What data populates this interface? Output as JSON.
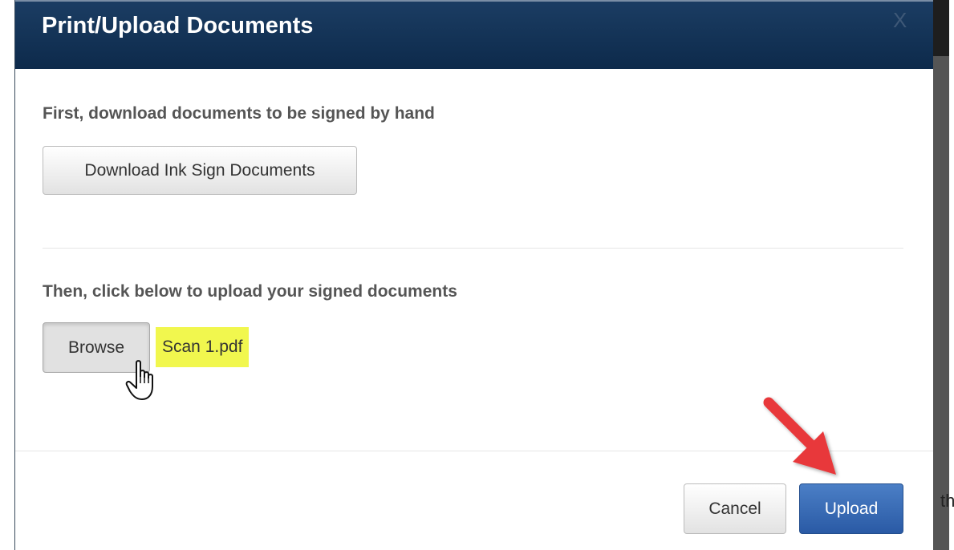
{
  "dialog": {
    "title": "Print/Upload Documents",
    "close_label": "X"
  },
  "step1": {
    "label": "First, download documents to be signed by hand",
    "button_label": "Download Ink Sign Documents"
  },
  "step2": {
    "label": "Then, click below to upload your signed documents",
    "browse_label": "Browse",
    "selected_file": "Scan 1.pdf"
  },
  "footer": {
    "cancel_label": "Cancel",
    "upload_label": "Upload"
  },
  "background": {
    "partial_text": "th"
  },
  "icons": {
    "cursor": "hand-pointer-icon",
    "annotation": "red-arrow-icon"
  },
  "colors": {
    "header_bg": "#12345a",
    "primary_button": "#3567b3",
    "file_highlight": "#f1f74e",
    "annotation_arrow": "#e8393a"
  }
}
